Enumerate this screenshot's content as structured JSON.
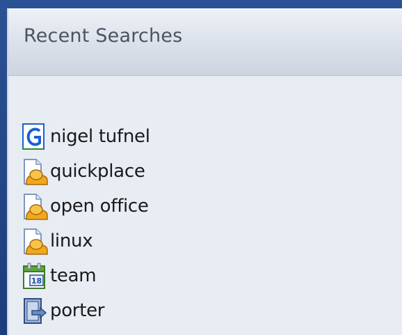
{
  "panel": {
    "title": "Recent Searches"
  },
  "searches": [
    {
      "label": "nigel tufnel",
      "icon": "google-icon"
    },
    {
      "label": "quickplace",
      "icon": "local-search-icon"
    },
    {
      "label": "open office",
      "icon": "local-search-icon"
    },
    {
      "label": "linux",
      "icon": "local-search-icon"
    },
    {
      "label": "team",
      "icon": "calendar-icon"
    },
    {
      "label": "porter",
      "icon": "contact-card-icon"
    }
  ],
  "colors": {
    "frame": "#1f3f7e",
    "panel_bg": "#e8ecf3",
    "header_text": "#4a5364"
  }
}
